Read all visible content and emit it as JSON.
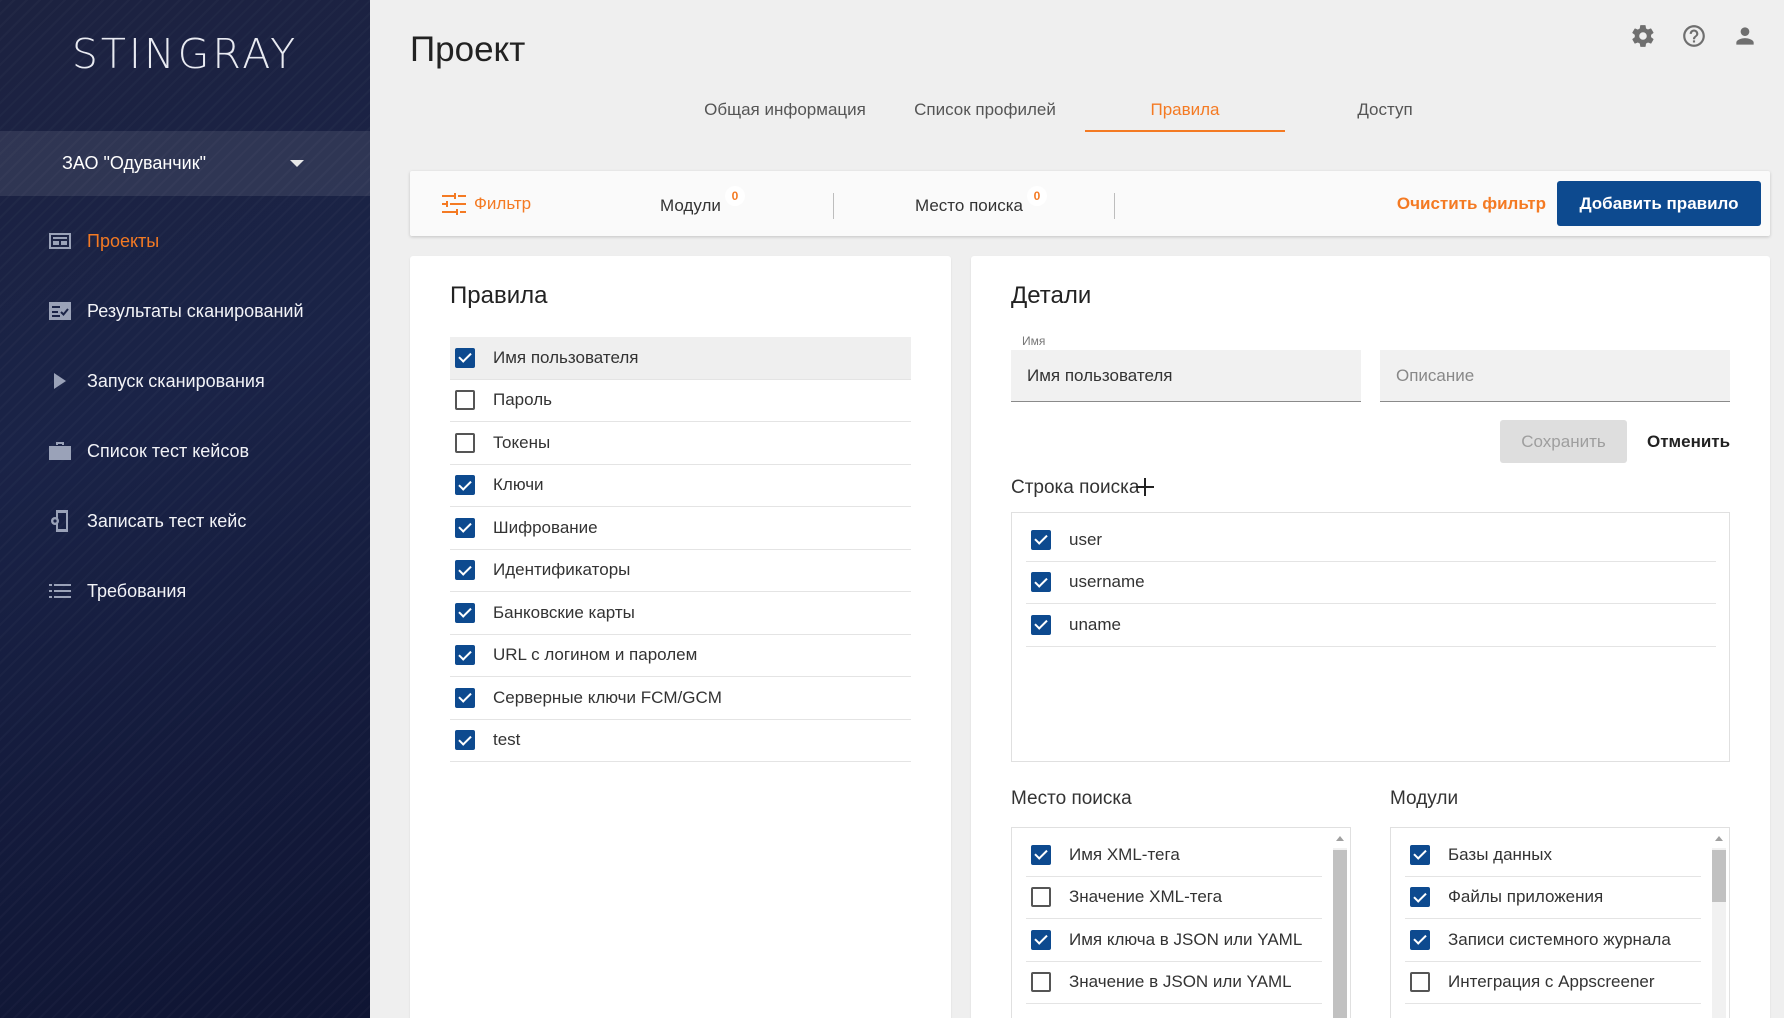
{
  "app": {
    "logo": "STINGRAY"
  },
  "sidebar": {
    "org": "ЗАО \"Одуванчик\"",
    "items": [
      {
        "label": "Проекты",
        "icon": "projects-icon",
        "active": true
      },
      {
        "label": "Результаты сканирований",
        "icon": "scan-results-icon",
        "active": false
      },
      {
        "label": "Запуск сканирования",
        "icon": "play-icon",
        "active": false
      },
      {
        "label": "Список тест кейсов",
        "icon": "briefcase-icon",
        "active": false
      },
      {
        "label": "Записать тест кейс",
        "icon": "phone-record-icon",
        "active": false
      },
      {
        "label": "Требования",
        "icon": "list-icon",
        "active": false
      }
    ]
  },
  "header": {
    "title": "Проект",
    "tabs": [
      {
        "label": "Общая информация",
        "active": false
      },
      {
        "label": "Список профилей",
        "active": false
      },
      {
        "label": "Правила",
        "active": true
      },
      {
        "label": "Доступ",
        "active": false
      }
    ],
    "icons": [
      "gear-icon",
      "help-icon",
      "account-icon"
    ]
  },
  "filterbar": {
    "filter_label": "Фильтр",
    "modules_label": "Модули",
    "modules_count": "0",
    "place_label": "Место поиска",
    "place_count": "0",
    "clear_label": "Очистить фильтр",
    "add_label": "Добавить правило"
  },
  "rules": {
    "title": "Правила",
    "items": [
      {
        "label": "Имя пользователя",
        "checked": true,
        "selected": true
      },
      {
        "label": "Пароль",
        "checked": false
      },
      {
        "label": "Токены",
        "checked": false
      },
      {
        "label": "Ключи",
        "checked": true
      },
      {
        "label": "Шифрование",
        "checked": true
      },
      {
        "label": "Идентификаторы",
        "checked": true
      },
      {
        "label": "Банковские карты",
        "checked": true
      },
      {
        "label": "URL с логином и паролем",
        "checked": true
      },
      {
        "label": "Серверные ключи FCM/GCM",
        "checked": true
      },
      {
        "label": "test",
        "checked": true
      }
    ]
  },
  "details": {
    "title": "Детали",
    "name_label": "Имя",
    "name_value": "Имя пользователя",
    "description_placeholder": "Описание",
    "save_label": "Сохранить",
    "cancel_label": "Отменить",
    "search_string_title": "Строка поиска",
    "search_strings": [
      {
        "label": "user",
        "checked": true
      },
      {
        "label": "username",
        "checked": true
      },
      {
        "label": "uname",
        "checked": true
      }
    ],
    "place_title": "Место поиска",
    "places": [
      {
        "label": "Имя XML-тега",
        "checked": true
      },
      {
        "label": "Значение XML-тега",
        "checked": false
      },
      {
        "label": "Имя ключа в JSON или YAML",
        "checked": true
      },
      {
        "label": "Значение в JSON или YAML",
        "checked": false
      }
    ],
    "modules_title": "Модули",
    "modules": [
      {
        "label": "Базы данных",
        "checked": true
      },
      {
        "label": "Файлы приложения",
        "checked": true
      },
      {
        "label": "Записи системного журнала",
        "checked": true
      },
      {
        "label": "Интеграция с Appscreener",
        "checked": false
      }
    ]
  },
  "colors": {
    "accent": "#f47a23",
    "primary": "#0d4a8f",
    "sidebar": "#1a2347"
  }
}
